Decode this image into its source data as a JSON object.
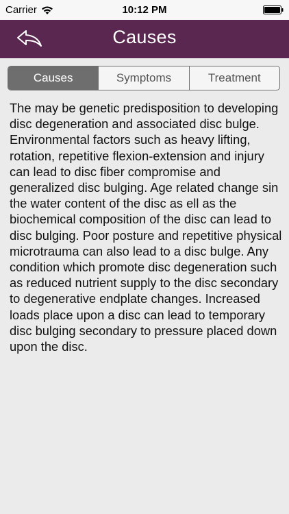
{
  "status_bar": {
    "carrier": "Carrier",
    "time": "10:12 PM"
  },
  "nav": {
    "title": "Causes",
    "back_icon": "back-arrow-icon"
  },
  "tabs": [
    {
      "label": "Causes",
      "active": true
    },
    {
      "label": "Symptoms",
      "active": false
    },
    {
      "label": "Treatment",
      "active": false
    }
  ],
  "content": {
    "body": "The may be genetic predisposition to developing disc degeneration and associated disc bulge. Environmental factors such as heavy lifting, rotation, repetitive flexion-extension and injury can lead to disc fiber compromise and generalized disc bulging. Age related change sin the water content of the disc as ell as the biochemical composition of the disc can lead to disc bulging. Poor posture and repetitive physical microtrauma can also lead to a disc bulge. Any condition which promote disc degeneration such as reduced nutrient supply to the disc secondary to degenerative endplate changes. Increased loads place upon a disc can lead to temporary disc bulging secondary to pressure placed down upon the disc."
  },
  "colors": {
    "nav_background": "#5a2750",
    "active_segment": "#6e6e6e",
    "page_background": "#ebebeb"
  }
}
